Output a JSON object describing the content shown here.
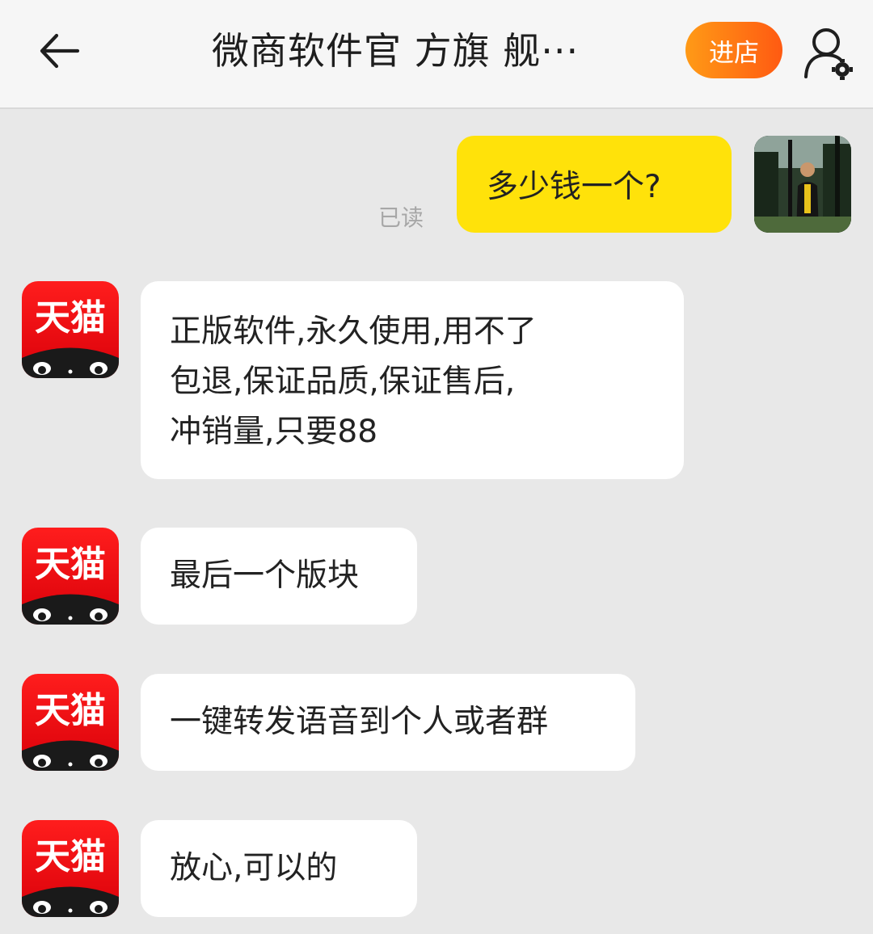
{
  "header": {
    "back_icon": "back-arrow-icon",
    "title": "微商软件官  方旗  舰···",
    "store_button": "进店",
    "profile_icon": "user-settings-icon"
  },
  "conversation": {
    "read_status": "已读",
    "outgoing": [
      {
        "text": "多少钱一个?"
      }
    ],
    "shop_avatar_label": "天猫",
    "incoming": [
      {
        "text": "正版软件,永久使用,用不了\n包退,保证品质,保证售后,\n冲销量,只要88"
      },
      {
        "text": "最后一个版块"
      },
      {
        "text": "一键转发语音到个人或者群"
      },
      {
        "text": "放心,可以的"
      }
    ]
  },
  "colors": {
    "own_bubble": "#ffe20a",
    "incoming_bubble": "#ffffff",
    "store_button": "#ff6a12",
    "tmall_red": "#ee0a10",
    "background": "#e8e8e8"
  }
}
